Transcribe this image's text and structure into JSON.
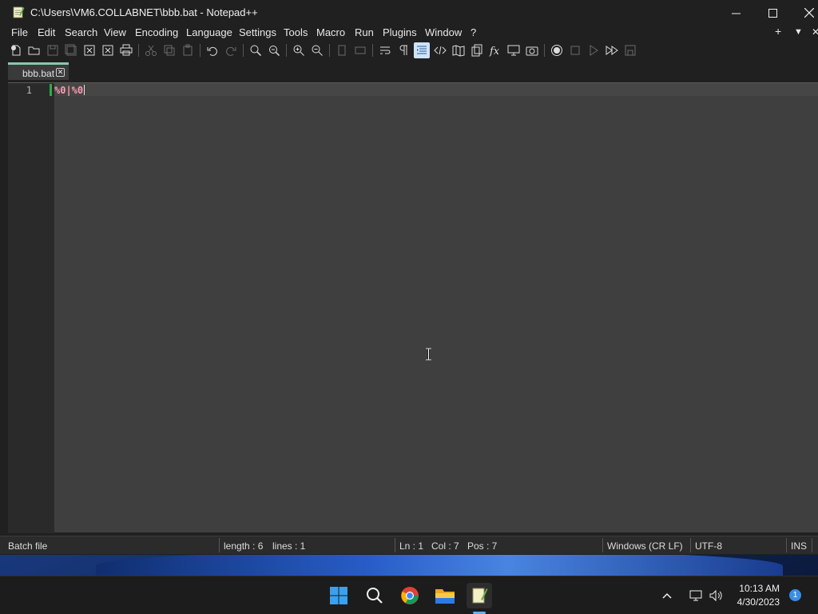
{
  "window": {
    "title": "C:\\Users\\VM6.COLLABNET\\bbb.bat - Notepad++"
  },
  "menu": {
    "items": [
      "File",
      "Edit",
      "Search",
      "View",
      "Encoding",
      "Language",
      "Settings",
      "Tools",
      "Macro",
      "Run",
      "Plugins",
      "Window",
      "?"
    ],
    "right_plus": "+",
    "right_down": "▼",
    "right_close": "✕"
  },
  "tab": {
    "label": "bbb.bat"
  },
  "editor": {
    "line_number": "1",
    "content": "%0|%0"
  },
  "status": {
    "file_type": "Batch file",
    "length": "length : 6",
    "lines": "lines : 1",
    "ln": "Ln : 1",
    "col": "Col : 7",
    "pos": "Pos : 7",
    "eol": "Windows (CR LF)",
    "encoding": "UTF-8",
    "mode": "INS"
  },
  "tray": {
    "time": "10:13 AM",
    "date": "4/30/2023",
    "notifications": "1"
  },
  "colors": {
    "accent_tab": "#8ac7ac",
    "syntax_operator": "#ff9bb3",
    "change_marker": "#2eab4a"
  }
}
